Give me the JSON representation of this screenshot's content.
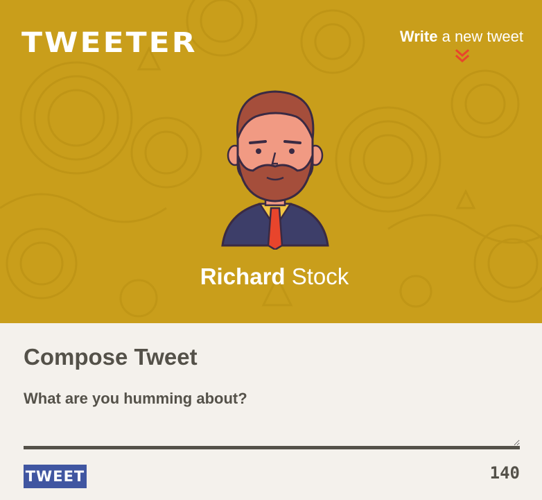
{
  "header": {
    "logo": "TWEETER",
    "write_link": {
      "strong": "Write",
      "light": "a new tweet"
    },
    "chevron_icon": "double-chevron-down",
    "accent_color": "#e8452c",
    "background_color": "#c99e1b"
  },
  "profile": {
    "first_name": "Richard",
    "last_name": "Stock",
    "avatar_icon": "bearded-man-avatar"
  },
  "compose": {
    "title": "Compose Tweet",
    "placeholder": "What are you humming about?",
    "value": "",
    "button_label": "TWEET",
    "counter": "140",
    "button_color": "#4056a1",
    "text_color": "#545149"
  }
}
